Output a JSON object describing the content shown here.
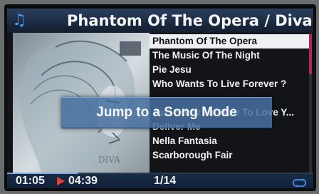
{
  "header": {
    "title": "Phantom Of The Opera / Diva The",
    "icon": "music-note-icon"
  },
  "playlist": {
    "items": [
      {
        "label": "Phantom Of The Opera",
        "selected": true
      },
      {
        "label": "The Music Of The Night",
        "selected": false
      },
      {
        "label": "Pie Jesu",
        "selected": false
      },
      {
        "label": "Who Wants To Live Forever ?",
        "selected": false
      },
      {
        "label": "Just Show Me How To Love Y...",
        "selected": false
      },
      {
        "label": "Deliver Me",
        "selected": false
      },
      {
        "label": "Nella Fantasia",
        "selected": false
      },
      {
        "label": "Scarborough Fair",
        "selected": false
      }
    ]
  },
  "overlay": {
    "message": "Jump to a Song Mode"
  },
  "playback": {
    "elapsed": "01:05",
    "total": "04:39",
    "track_position": "1/14",
    "progress": 0.23,
    "state_icon": "play-icon",
    "repeat_icon": "repeat-icon"
  },
  "colors": {
    "header_bg": "#1b2a40",
    "selection_bg": "#eef0f2",
    "overlay_bg": "#4670a0",
    "play_icon": "#e0413a",
    "scroll_thumb": "#b3245c",
    "accent": "#4f9be6"
  }
}
